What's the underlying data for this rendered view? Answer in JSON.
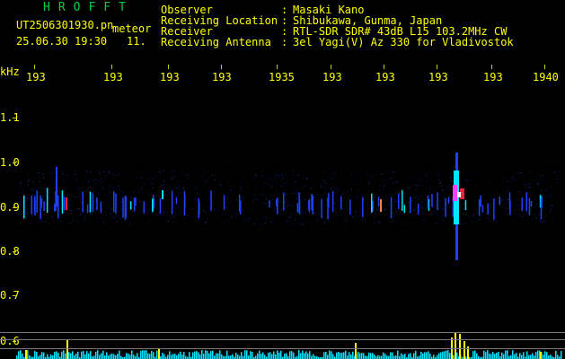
{
  "header": {
    "app_name": "HROFFT",
    "filename": "UT2506301930.pn",
    "type_word": "meteor",
    "datetime": "25.06.30 19:30",
    "count": "11.",
    "fields": [
      {
        "label": "Observer",
        "value": "Masaki Kano"
      },
      {
        "label": "Receiving Location",
        "value": "Shibukawa, Gunma, Japan"
      },
      {
        "label": "Receiver",
        "value": "RTL-SDR SDR# 43dB L15 103.2MHz CW"
      },
      {
        "label": "Receiving Antenna",
        "value": "3el Yagi(V) Az 330 for Vladivostok"
      }
    ],
    "separator": ":"
  },
  "time_axis": {
    "ticks": [
      "193",
      "193",
      "193",
      "193",
      "1935",
      "193",
      "193",
      "193",
      "193",
      "1940"
    ]
  },
  "freq_axis": {
    "unit": "kHz",
    "ticks": [
      "1.1",
      "1.0",
      "0.9",
      "0.8",
      "0.7",
      "0.6"
    ]
  },
  "colors": {
    "text": "#ffff00",
    "title": "#00cc44",
    "signal_blue": "#2040ff",
    "signal_cyan": "#00e5ff",
    "signal_red": "#ff2040",
    "signal_magenta": "#ff40ff",
    "bars_yellow": "#ffff00"
  }
}
